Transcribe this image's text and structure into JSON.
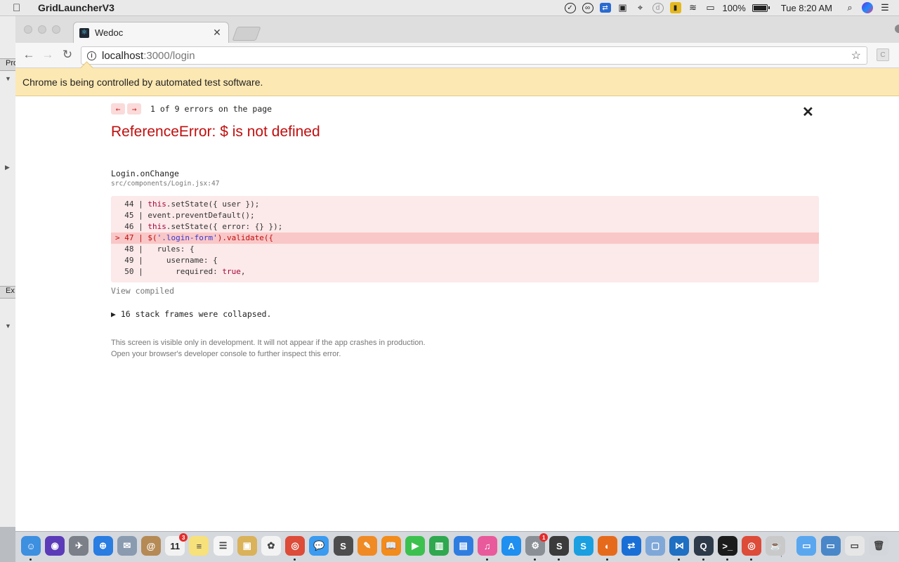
{
  "menubar": {
    "app_name": "GridLauncherV3",
    "battery": "100%",
    "clock": "Tue 8:20 AM",
    "icons": [
      "check-circle-icon",
      "creative-cloud-icon",
      "teamviewer-icon",
      "camera-icon",
      "location-icon",
      "dashlane-icon",
      "keychain-icon",
      "wifi-icon",
      "airplay-icon",
      "battery-icon",
      "spotlight-icon",
      "siri-icon",
      "notification-center-icon"
    ]
  },
  "background_window": {
    "label_top": "Pro",
    "label_bottom": "Ex"
  },
  "browser": {
    "tab_title": "Wedoc",
    "url_host": "localhost",
    "url_path": ":3000/login",
    "extension_letter": "C",
    "infobar_text": "Chrome is being controlled by automated test software."
  },
  "error_overlay": {
    "error_count": "1 of 9 errors on the page",
    "title": "ReferenceError: $ is not defined",
    "function_name": "Login.onChange",
    "file_location": "src/components/Login.jsx:47",
    "code_lines": [
      {
        "prefix": "  44 | ",
        "parts": [
          {
            "t": "this",
            "c": "kw"
          },
          {
            "t": ".setState({ user });",
            "c": ""
          }
        ]
      },
      {
        "prefix": "  45 | ",
        "parts": [
          {
            "t": "event.preventDefault();",
            "c": ""
          }
        ]
      },
      {
        "prefix": "  46 | ",
        "parts": [
          {
            "t": "this",
            "c": "kw"
          },
          {
            "t": ".setState({ error: {} });",
            "c": ""
          }
        ]
      },
      {
        "prefix": "> 47 | ",
        "highlight": true,
        "parts": [
          {
            "t": "$(",
            "c": ""
          },
          {
            "t": "'.login-form'",
            "c": "str"
          },
          {
            "t": ").validate({",
            "c": ""
          }
        ]
      },
      {
        "prefix": "  48 | ",
        "parts": [
          {
            "t": "  rules: {",
            "c": ""
          }
        ]
      },
      {
        "prefix": "  49 | ",
        "parts": [
          {
            "t": "    username: {",
            "c": ""
          }
        ]
      },
      {
        "prefix": "  50 | ",
        "parts": [
          {
            "t": "      required: ",
            "c": ""
          },
          {
            "t": "true",
            "c": "kw"
          },
          {
            "t": ",",
            "c": ""
          }
        ]
      }
    ],
    "view_compiled": "View compiled",
    "collapsed_frames": "▶ 16 stack frames were collapsed.",
    "footer_line1": "This screen is visible only in development. It will not appear if the app crashes in production.",
    "footer_line2": "Open your browser's developer console to further inspect this error."
  },
  "dock": {
    "calendar_day": "11",
    "calendar_badge": "3",
    "sysprefs_badge": "1",
    "apps": [
      {
        "name": "finder-icon",
        "color": "#3d8fe0",
        "glyph": "☺",
        "dot": true
      },
      {
        "name": "siri-dock-icon",
        "color": "#5b3bb8",
        "glyph": "◉",
        "dot": false
      },
      {
        "name": "launchpad-icon",
        "color": "#7a7f88",
        "glyph": "✈",
        "dot": false
      },
      {
        "name": "safari-icon",
        "color": "#2a7de1",
        "glyph": "⊕",
        "dot": false
      },
      {
        "name": "mail-bird-icon",
        "color": "#8a9bb0",
        "glyph": "✉",
        "dot": false
      },
      {
        "name": "contacts-icon",
        "color": "#b58a55",
        "glyph": "@",
        "dot": false
      },
      {
        "name": "calendar-icon",
        "color": "#f2f2f2",
        "glyph": "",
        "dot": false
      },
      {
        "name": "notes-icon",
        "color": "#f7e17a",
        "glyph": "≡",
        "dot": false
      },
      {
        "name": "reminders-icon",
        "color": "#f5f5f5",
        "glyph": "☰",
        "dot": false
      },
      {
        "name": "preview-icon",
        "color": "#d9b25a",
        "glyph": "▣",
        "dot": false
      },
      {
        "name": "photos-icon",
        "color": "#f3f3f3",
        "glyph": "✿",
        "dot": false
      },
      {
        "name": "chrome-icon",
        "color": "#dd4b39",
        "glyph": "◎",
        "dot": true
      },
      {
        "name": "messages-icon",
        "color": "#3a9bf0",
        "glyph": "💬",
        "dot": false
      },
      {
        "name": "sublime-icon",
        "color": "#4d4d4d",
        "glyph": "S",
        "dot": false
      },
      {
        "name": "pages-icon",
        "color": "#f08a24",
        "glyph": "✎",
        "dot": false
      },
      {
        "name": "ibooks-icon",
        "color": "#f28c1b",
        "glyph": "📖",
        "dot": false
      },
      {
        "name": "facetime-icon",
        "color": "#3cc14f",
        "glyph": "▶",
        "dot": false
      },
      {
        "name": "numbers-icon",
        "color": "#2fa84f",
        "glyph": "▥",
        "dot": false
      },
      {
        "name": "keynote-icon",
        "color": "#2f7de0",
        "glyph": "▤",
        "dot": false
      },
      {
        "name": "itunes-icon",
        "color": "#e85a9b",
        "glyph": "♫",
        "dot": true
      },
      {
        "name": "app-store-icon",
        "color": "#1f8ff0",
        "glyph": "A",
        "dot": false
      },
      {
        "name": "system-preferences-icon",
        "color": "#8a8f96",
        "glyph": "⚙",
        "dot": true
      },
      {
        "name": "sublime-text-icon",
        "color": "#3b3b3b",
        "glyph": "S",
        "dot": true
      },
      {
        "name": "skype-icon",
        "color": "#1a9fe0",
        "glyph": "S",
        "dot": false
      },
      {
        "name": "firefox-icon",
        "color": "#e66a1c",
        "glyph": "◐",
        "dot": true
      },
      {
        "name": "teamviewer-dock-icon",
        "color": "#1a6fd6",
        "glyph": "⇄",
        "dot": false
      },
      {
        "name": "virtualbox-icon",
        "color": "#7fa8d8",
        "glyph": "▢",
        "dot": false
      },
      {
        "name": "vscode-icon",
        "color": "#1f6fc2",
        "glyph": "⋈",
        "dot": true
      },
      {
        "name": "quicktime-icon",
        "color": "#2d3a4a",
        "glyph": "Q",
        "dot": true
      },
      {
        "name": "terminal-icon",
        "color": "#1b1b1b",
        "glyph": ">_",
        "dot": true
      },
      {
        "name": "chrome-2-icon",
        "color": "#dd4b39",
        "glyph": "◎",
        "dot": true
      },
      {
        "name": "java-icon",
        "color": "#c9c9c9",
        "glyph": "☕",
        "dot": false
      },
      {
        "name": "downloads-folder-icon",
        "color": "#5aa7ef",
        "glyph": "▭",
        "dot": false
      },
      {
        "name": "screen-sharing-icon",
        "color": "#4a87c9",
        "glyph": "▭",
        "dot": false
      },
      {
        "name": "screenshots-stack-icon",
        "color": "#e6e6e6",
        "glyph": "▭",
        "dot": false
      },
      {
        "name": "trash-icon",
        "color": "#d3d6da",
        "glyph": "🗑",
        "dot": false
      }
    ]
  }
}
